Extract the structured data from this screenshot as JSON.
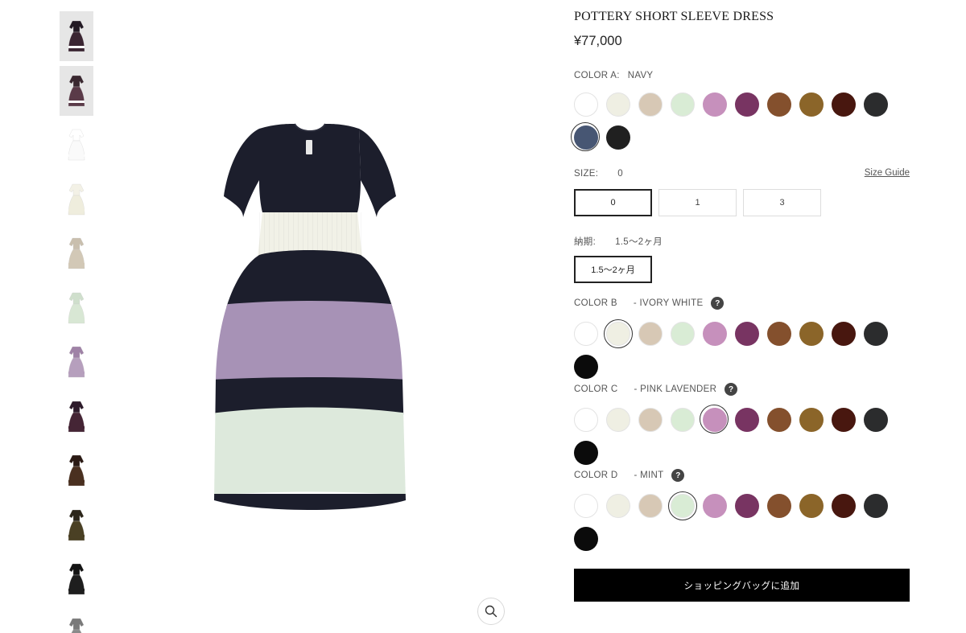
{
  "product": {
    "title": "POTTERY SHORT SLEEVE DRESS",
    "price": "¥77,000"
  },
  "palette": {
    "navy": "#1c1e2c",
    "ivory": "#f1f1e7",
    "lavender": "#a792b6",
    "mint": "#dde9dc"
  },
  "thumbnails": [
    {
      "name": "thumb-navy-multi",
      "top": "#231a24",
      "skirt": "#3a2532",
      "hem": "#ffffff",
      "selected": true
    },
    {
      "name": "thumb-navy-multi-back",
      "top": "#3a2830",
      "skirt": "#5a3a48",
      "hem": "#ffffff",
      "selected": true
    },
    {
      "name": "thumb-white",
      "top": "#ffffff",
      "skirt": "#fafafa",
      "hem": "#fafafa",
      "selected": false
    },
    {
      "name": "thumb-ivory",
      "top": "#f3f1e6",
      "skirt": "#efeddd",
      "hem": "#efeddd",
      "selected": false
    },
    {
      "name": "thumb-beige",
      "top": "#c9bfae",
      "skirt": "#d2c8b6",
      "hem": "#d2c8b6",
      "selected": false
    },
    {
      "name": "thumb-mint",
      "top": "#cfdfcc",
      "skirt": "#d8e7d4",
      "hem": "#d8e7d4",
      "selected": false
    },
    {
      "name": "thumb-lavender",
      "top": "#9f82a6",
      "skirt": "#b69fbd",
      "hem": "#b69fbd",
      "selected": false
    },
    {
      "name": "thumb-plum",
      "top": "#2d1a2a",
      "skirt": "#452535",
      "hem": "#452535",
      "selected": false
    },
    {
      "name": "thumb-brown",
      "top": "#2b1a14",
      "skirt": "#4a3020",
      "hem": "#4a3020",
      "selected": false
    },
    {
      "name": "thumb-olive",
      "top": "#2c261a",
      "skirt": "#4a4024",
      "hem": "#4a4024",
      "selected": false
    },
    {
      "name": "thumb-black",
      "top": "#141414",
      "skirt": "#1e1e1e",
      "hem": "#1e1e1e",
      "selected": false
    },
    {
      "name": "thumb-grey",
      "top": "#7a7a7a",
      "skirt": "#8a8a8a",
      "hem": "#8a8a8a",
      "selected": false
    }
  ],
  "swatch_colors": [
    {
      "name": "white",
      "hex": "#ffffff",
      "light": true
    },
    {
      "name": "ivory",
      "hex": "#efefe3",
      "light": true
    },
    {
      "name": "beige",
      "hex": "#d7c8b5",
      "light": true
    },
    {
      "name": "mint",
      "hex": "#d9ecd5",
      "light": true
    },
    {
      "name": "pink-lavender",
      "hex": "#c690bc",
      "light": false
    },
    {
      "name": "plum",
      "hex": "#783462",
      "light": false
    },
    {
      "name": "brown",
      "hex": "#84502d",
      "light": false
    },
    {
      "name": "ochre",
      "hex": "#8b6529",
      "light": false
    },
    {
      "name": "chocolate",
      "hex": "#48170f",
      "light": false
    },
    {
      "name": "charcoal",
      "hex": "#2b2c2d",
      "light": false
    }
  ],
  "color_a": {
    "label": "COLOR A:",
    "value": "NAVY",
    "extra": [
      {
        "name": "navy",
        "hex": "#475673",
        "light": false
      },
      {
        "name": "black",
        "hex": "#202020",
        "light": false
      }
    ],
    "selected": "navy"
  },
  "size": {
    "label": "SIZE:",
    "value": "0",
    "guide": "Size Guide",
    "options": [
      "0",
      "1",
      "3"
    ],
    "selected": "0"
  },
  "delivery": {
    "label": "納期:",
    "value": "1.5〜2ヶ月",
    "options": [
      "1.5〜2ヶ月"
    ]
  },
  "color_b": {
    "label": "COLOR B",
    "value": "- IVORY WHITE",
    "help": "?",
    "extra": [
      {
        "name": "black",
        "hex": "#0b0b0b",
        "light": false
      }
    ],
    "selected": "ivory"
  },
  "color_c": {
    "label": "COLOR C",
    "value": "- PINK LAVENDER",
    "help": "?",
    "extra": [
      {
        "name": "black",
        "hex": "#0b0b0b",
        "light": false
      }
    ],
    "selected": "pink-lavender"
  },
  "color_d": {
    "label": "COLOR D",
    "value": "- MINT",
    "help": "?",
    "extra": [
      {
        "name": "black",
        "hex": "#0b0b0b",
        "light": false
      }
    ],
    "selected": "mint"
  },
  "cart": {
    "add_label": "ショッピングバッグに追加"
  },
  "zoom": {
    "icon": "magnifier-icon"
  }
}
